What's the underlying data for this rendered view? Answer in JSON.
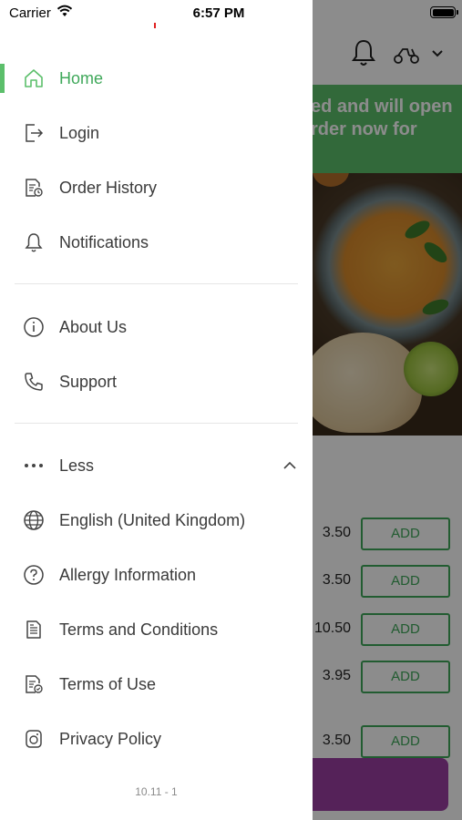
{
  "status_bar": {
    "carrier": "Carrier",
    "time": "6:57 PM"
  },
  "background": {
    "banner_lines": [
      "ed and will open",
      "rder now for"
    ],
    "items": [
      {
        "price": "3.50",
        "add_label": "ADD"
      },
      {
        "price": "3.50",
        "add_label": "ADD"
      },
      {
        "price": "10.50",
        "add_label": "ADD"
      },
      {
        "price": "3.95",
        "add_label": "ADD"
      },
      {
        "price": "3.50",
        "add_label": "ADD"
      }
    ]
  },
  "menu": {
    "section1": [
      {
        "label": "Home",
        "icon": "home-icon",
        "active": true
      },
      {
        "label": "Login",
        "icon": "login-icon"
      },
      {
        "label": "Order History",
        "icon": "order-history-icon"
      },
      {
        "label": "Notifications",
        "icon": "bell-icon"
      }
    ],
    "section2": [
      {
        "label": "About Us",
        "icon": "info-icon"
      },
      {
        "label": "Support",
        "icon": "phone-icon"
      }
    ],
    "less_label": "Less",
    "section3": [
      {
        "label": "English (United Kingdom)",
        "icon": "globe-icon"
      },
      {
        "label": "Allergy Information",
        "icon": "question-icon"
      },
      {
        "label": "Terms and Conditions",
        "icon": "document-icon"
      },
      {
        "label": "Terms of Use",
        "icon": "document-check-icon"
      },
      {
        "label": "Privacy Policy",
        "icon": "privacy-icon"
      }
    ]
  },
  "version": "10.11 - 1",
  "colors": {
    "accent": "#5cbf6b",
    "active_text": "#3fa85a",
    "cart": "#9b3fa3"
  }
}
